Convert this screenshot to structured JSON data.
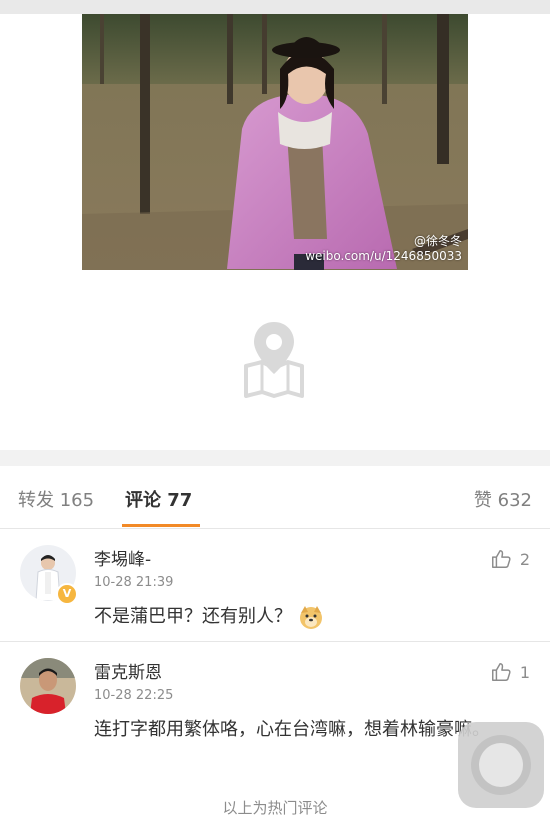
{
  "photo": {
    "watermark_name": "@徐冬冬",
    "watermark_url": "weibo.com/u/1246850033"
  },
  "tabs": {
    "repost": "转发 165",
    "comments": "评论 77",
    "likes": "赞 632"
  },
  "comments": [
    {
      "username": "李埸峰-",
      "time": "10-28 21:39",
      "text": "不是蒲巴甲？还有别人？",
      "likes": "2",
      "badge": "V"
    },
    {
      "username": "雷克斯恩",
      "time": "10-28 22:25",
      "text": "连打字都用繁体咯，心在台湾嘛，想着林输豪嘛。",
      "likes": "1"
    }
  ],
  "footer": {
    "note": "以上为热门评论"
  },
  "icons": {
    "map": "map-pin-icon",
    "like": "thumbs-up-icon",
    "emoji": "doge-emoji-icon",
    "assistive": "assistive-touch-icon"
  },
  "colors": {
    "accent": "#f28a27",
    "text": "#333333",
    "muted": "#8c8c8c"
  }
}
